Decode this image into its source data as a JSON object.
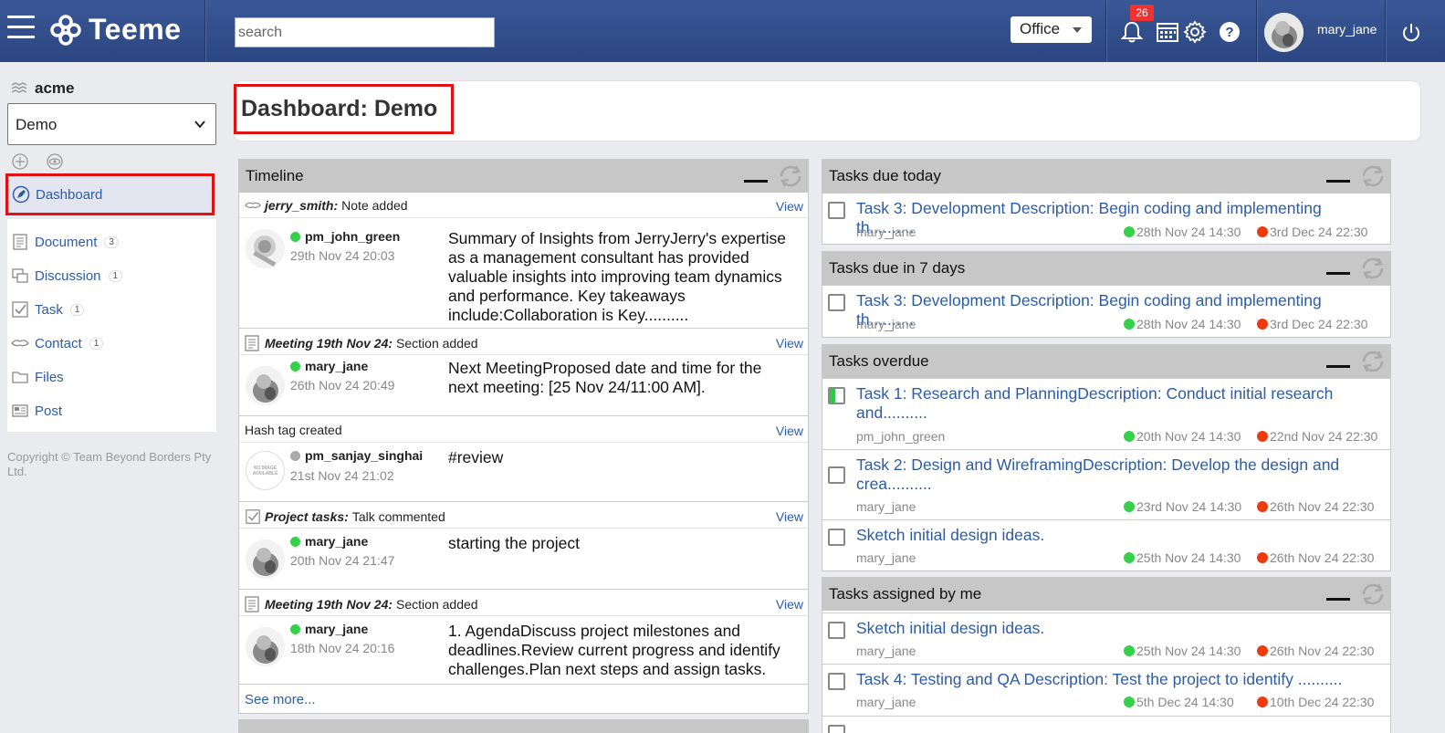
{
  "app": {
    "name": "Teeme"
  },
  "header": {
    "search_placeholder": "search",
    "office_label": "Office",
    "notification_count": "26",
    "username": "mary_jane",
    "icons": [
      "menu-icon",
      "bell-icon",
      "calendar-icon",
      "gear-icon",
      "help-icon",
      "power-icon"
    ]
  },
  "sidebar": {
    "org_name": "acme",
    "space_select": "Demo",
    "active_item": {
      "label": "Dashboard",
      "icon": "dashboard-icon"
    },
    "items": [
      {
        "label": "Document",
        "count": "3",
        "icon": "document-icon"
      },
      {
        "label": "Discussion",
        "count": "1",
        "icon": "discussion-icon"
      },
      {
        "label": "Task",
        "count": "1",
        "icon": "task-icon"
      },
      {
        "label": "Contact",
        "count": "1",
        "icon": "contact-icon"
      },
      {
        "label": "Files",
        "count": "",
        "icon": "folder-icon"
      },
      {
        "label": "Post",
        "count": "",
        "icon": "post-icon"
      }
    ],
    "copyright": "Copyright © Team Beyond Borders Pty Ltd."
  },
  "page": {
    "title": "Dashboard: Demo"
  },
  "timeline": {
    "title": "Timeline",
    "view_label": "View",
    "see_more": "See more...",
    "entries": [
      {
        "context": "jerry_smith:",
        "action": "Note added",
        "user": "pm_john_green",
        "status": "online",
        "time": "29th Nov 24 20:03",
        "text": "Summary of Insights from JerryJerry's expertise as a management consultant has provided valuable insights into improving team dynamics and performance. Key takeaways include:Collaboration is Key.........."
      },
      {
        "context": "Meeting 19th Nov 24:",
        "action": "Section added",
        "user": "mary_jane",
        "status": "online",
        "time": "26th Nov 24 20:49",
        "text": "Next MeetingProposed date and time for the next meeting: [25 Nov 24/11:00 AM]."
      },
      {
        "context": "",
        "action": "Hash tag created",
        "user": "pm_sanjay_singhai",
        "status": "offline",
        "time": "21st Nov 24 21:02",
        "text": "#review",
        "no_image": "NO IMAGE AVAILABLE"
      },
      {
        "context": "Project tasks:",
        "action": "Talk commented",
        "user": "mary_jane",
        "status": "online",
        "time": "20th Nov 24 21:47",
        "text": "starting the project"
      },
      {
        "context": "Meeting 19th Nov 24:",
        "action": "Section added",
        "user": "mary_jane",
        "status": "online",
        "time": "18th Nov 24 20:16",
        "text": "1. AgendaDiscuss project milestones and deadlines.Review current progress and identify challenges.Plan next steps and assign tasks."
      }
    ]
  },
  "tasks_due_today": {
    "title": "Tasks due today",
    "tasks": [
      {
        "title": "Task 3: Development Description: Begin coding and implementing th..........",
        "user": "mary_jane",
        "start": "28th Nov 24 14:30",
        "end": "3rd Dec 24 22:30"
      }
    ]
  },
  "tasks_due_7days": {
    "title": "Tasks due in 7 days",
    "tasks": [
      {
        "title": "Task 3: Development Description: Begin coding and implementing th..........",
        "user": "mary_jane",
        "start": "28th Nov 24 14:30",
        "end": "3rd Dec 24 22:30"
      }
    ]
  },
  "tasks_overdue": {
    "title": "Tasks overdue",
    "tasks": [
      {
        "title": "Task 1: Research and PlanningDescription: Conduct initial research and..........",
        "user": "pm_john_green",
        "start": "20th Nov 24 14:30",
        "end": "22nd Nov 24 22:30",
        "progress": 0.4
      },
      {
        "title": "Task 2: Design and WireframingDescription: Develop the design and crea..........",
        "user": "mary_jane",
        "start": "23rd Nov 24 14:30",
        "end": "26th Nov 24 22:30"
      },
      {
        "title": "Sketch initial design ideas.",
        "user": "mary_jane",
        "start": "25th Nov 24 14:30",
        "end": "26th Nov 24 22:30"
      }
    ]
  },
  "tasks_assigned": {
    "title": "Tasks assigned by me",
    "tasks": [
      {
        "title": "Sketch initial design ideas.",
        "user": "mary_jane",
        "start": "25th Nov 24 14:30",
        "end": "26th Nov 24 22:30"
      },
      {
        "title": "Task 4: Testing and QA Description: Test the project to identify ..........",
        "user": "mary_jane",
        "start": "5th Dec 24 14:30",
        "end": "10th Dec 24 22:30"
      }
    ]
  },
  "colors": {
    "header": "#2f4c8a",
    "link": "#2b5ca8",
    "highlight": "#e01212",
    "online": "#35d14a",
    "due": "#ee3b0e"
  }
}
